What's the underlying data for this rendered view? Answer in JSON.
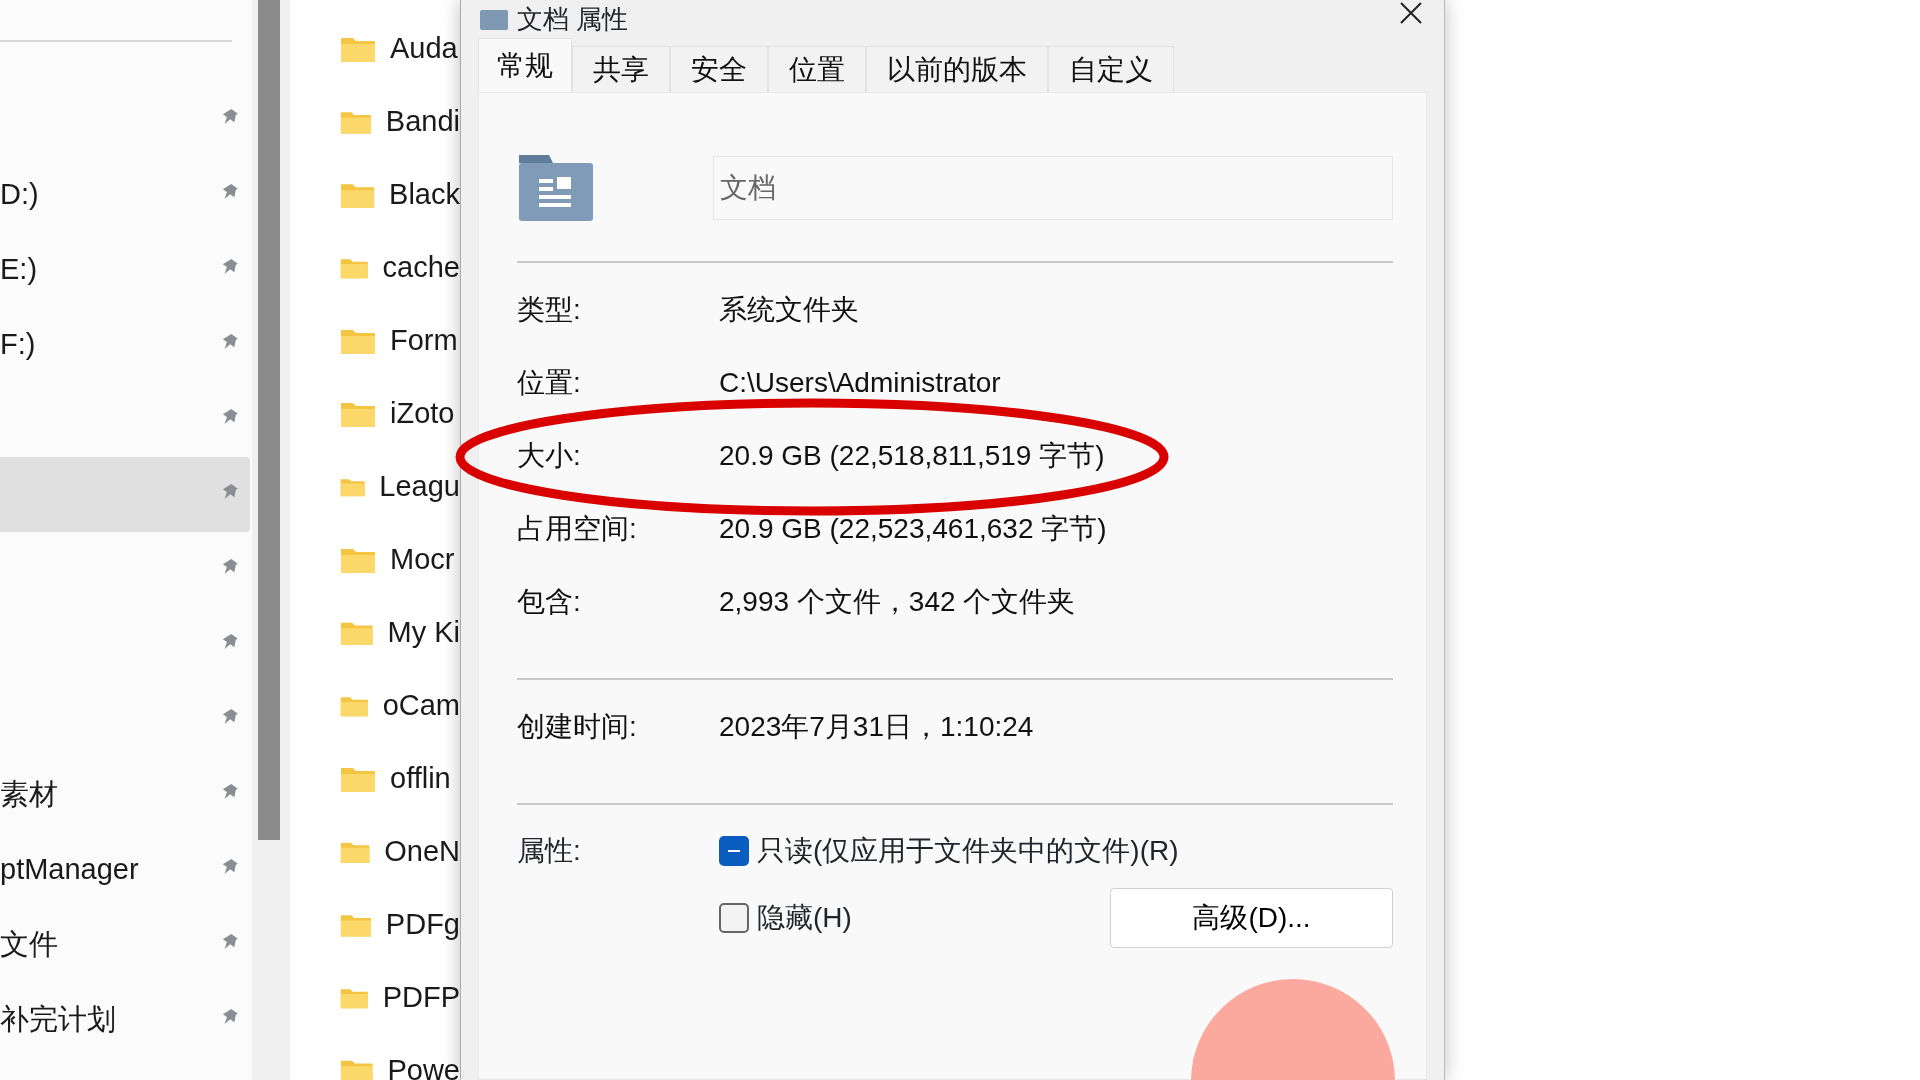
{
  "sidebar": {
    "items": [
      {
        "selected": false
      },
      {
        "label": "D:)",
        "selected": false
      },
      {
        "label": "E:)",
        "selected": false
      },
      {
        "label": "F:)",
        "selected": false
      },
      {
        "selected": false
      },
      {
        "selected": true
      },
      {
        "selected": false
      },
      {
        "selected": false
      },
      {
        "selected": false
      },
      {
        "label": "素材",
        "selected": false
      },
      {
        "label": "ptManager",
        "selected": false
      },
      {
        "label": "文件",
        "selected": false
      },
      {
        "label": "补完计划",
        "selected": false
      }
    ]
  },
  "folders": [
    "Auda",
    "Bandi",
    "Black",
    "cache",
    "Form",
    "iZoto",
    "Leagu",
    "Mocr",
    "My Ki",
    "oCam",
    "offlin",
    "OneN",
    "PDFg",
    "PDFP",
    "Powe"
  ],
  "dialog": {
    "title": "文档 属性",
    "tabs": [
      {
        "label": "常规",
        "selected": true
      },
      {
        "label": "共享",
        "selected": false
      },
      {
        "label": "安全",
        "selected": false
      },
      {
        "label": "位置",
        "selected": false
      },
      {
        "label": "以前的版本",
        "selected": false
      },
      {
        "label": "自定义",
        "selected": false
      }
    ],
    "name": "文档",
    "groups": [
      [
        {
          "label": "类型:",
          "value": "系统文件夹"
        },
        {
          "label": "位置:",
          "value": "C:\\Users\\Administrator"
        },
        {
          "label": "大小:",
          "value": "20.9 GB (22,518,811,519 字节)"
        },
        {
          "label": "占用空间:",
          "value": "20.9 GB (22,523,461,632 字节)"
        },
        {
          "label": "包含:",
          "value": "2,993 个文件，342 个文件夹"
        }
      ],
      [
        {
          "label": "创建时间:",
          "value": "2023年7月31日，1:10:24"
        }
      ]
    ],
    "attributes_label": "属性:",
    "attributes": [
      {
        "label": "只读(仅应用于文件夹中的文件)(R)",
        "indeterminate": true
      },
      {
        "label": "隐藏(H)",
        "checked": false
      }
    ],
    "advanced_button": "高级(D)..."
  }
}
